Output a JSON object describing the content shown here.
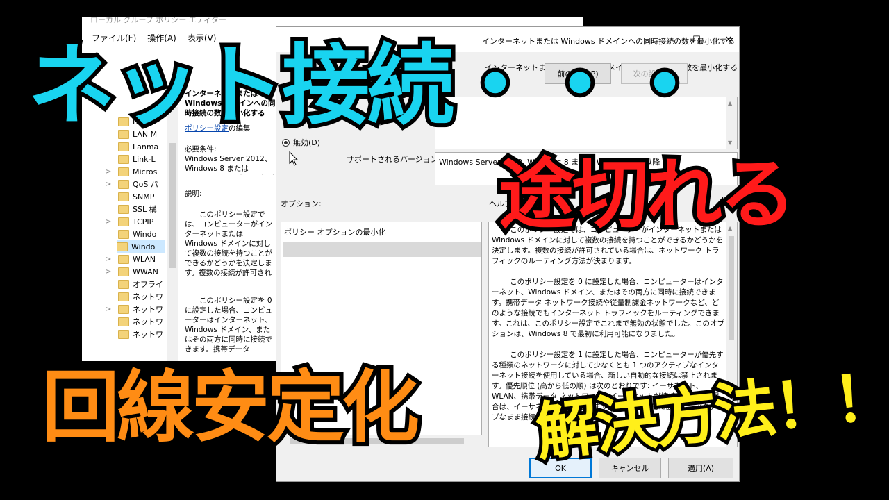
{
  "back_window": {
    "title": "ローカル グループ ポリシー エディター",
    "menu": [
      "ファイル(F)",
      "操作(A)",
      "表示(V)"
    ],
    "tree": [
      {
        "label": "D",
        "expander": false
      },
      {
        "label": "LAN M",
        "expander": false
      },
      {
        "label": "Lanma",
        "expander": false
      },
      {
        "label": "Link-L",
        "expander": false
      },
      {
        "label": "Micros",
        "expander": true
      },
      {
        "label": "QoS パ",
        "expander": true
      },
      {
        "label": "SNMP",
        "expander": false
      },
      {
        "label": "SSL 構",
        "expander": false
      },
      {
        "label": "TCPIP",
        "expander": true
      },
      {
        "label": "Windo",
        "expander": false
      },
      {
        "label": "Windo",
        "expander": false,
        "selected": true
      },
      {
        "label": "WLAN",
        "expander": true
      },
      {
        "label": "WWAN",
        "expander": true
      },
      {
        "label": "オフライ",
        "expander": false
      },
      {
        "label": "ネットワ",
        "expander": false
      },
      {
        "label": "ネットワ",
        "expander": true
      },
      {
        "label": "ネットワ",
        "expander": false
      },
      {
        "label": "ネットワ",
        "expander": false
      }
    ],
    "desc": {
      "heading": "インターネットまたは Windows ドメインへの同時接続の数を最小化する",
      "edit_link": "ポリシー設定",
      "edit_suffix": "の編集",
      "req_label": "必要条件:",
      "req_text": "Windows Server 2012、Windows 8 または Windows RT またはそれ以降",
      "expl_label": "説明:",
      "expl_text_1": "このポリシー設定では、コンピューターがインターネットまたは Windows ドメインに対して複数の接続を持つことができるかどうかを決定します。複数の接続が許可されている場合は、ネットワーク トラフィックのルーティング方法が決まります。",
      "expl_text_2": "このポリシー設定を 0 に設定した場合、コンピューターはインターネット、Windows ドメイン、またはその両方に同時に接続できます。携帯データ"
    }
  },
  "dialog": {
    "title": "インターネットまたは Windows ドメインへの同時接続の数を最小化する",
    "header_label": "インターネットまたは Windows ドメインへの同時接続の数を最小化する",
    "prev_button": "前の設定(P)",
    "next_button": "次の設定(N)",
    "radio_disabled": "無効(D)",
    "supported_label": "サポートされるバージョン:",
    "supported_value": "Windows Server 2012, Windows 8 または Windows RT 以降",
    "options_label": "オプション:",
    "help_label": "ヘルプ:",
    "options_header": "ポリシー オプションの最小化",
    "help_paragraphs": [
      "このポリシー設定では、コンピューターがインターネットまたは Windows ドメインに対して複数の接続を持つことができるかどうかを決定します。複数の接続が許可されている場合は、ネットワーク トラフィックのルーティング方法が決まります。",
      "このポリシー設定を 0 に設定した場合、コンピューターはインターネット、Windows ドメイン、またはその両方に同時に接続できます。携帯データ ネットワーク接続や従量制課金ネットワークなど、どのような接続でもインターネット トラフィックをルーティングできます。これは、このポリシー設定でこれまで無効の状態でした。このオプションは、Windows 8 で最初に利用可能になりました。",
      "このポリシー設定を 1 に設定した場合、コンピューターが優先する種類のネットワークに対して少なくとも 1 つのアクティブなインターネット接続を使用している場合、新しい自動的な接続は禁止されます。優先順位 (高から低の順) は次のとおりです: イーサネット、WLAN、携帯データ ネットワーク。イーサネットが接続されている場合は、イーサネットが優先されます。この動作は常に該当し、アクティブなまま接続できます。"
    ],
    "ok_button": "OK",
    "cancel_button": "キャンセル",
    "apply_button": "適用(A)"
  },
  "overlay": {
    "line1": "ネット接続・・・",
    "line2": "途切れる",
    "line3": "回線安定化",
    "line4": "解決方法！！",
    "colors": {
      "cyan": "#19d4f0",
      "red": "#ff1a1a",
      "orange": "#ff8c14",
      "yellow": "#ffef1a"
    }
  }
}
